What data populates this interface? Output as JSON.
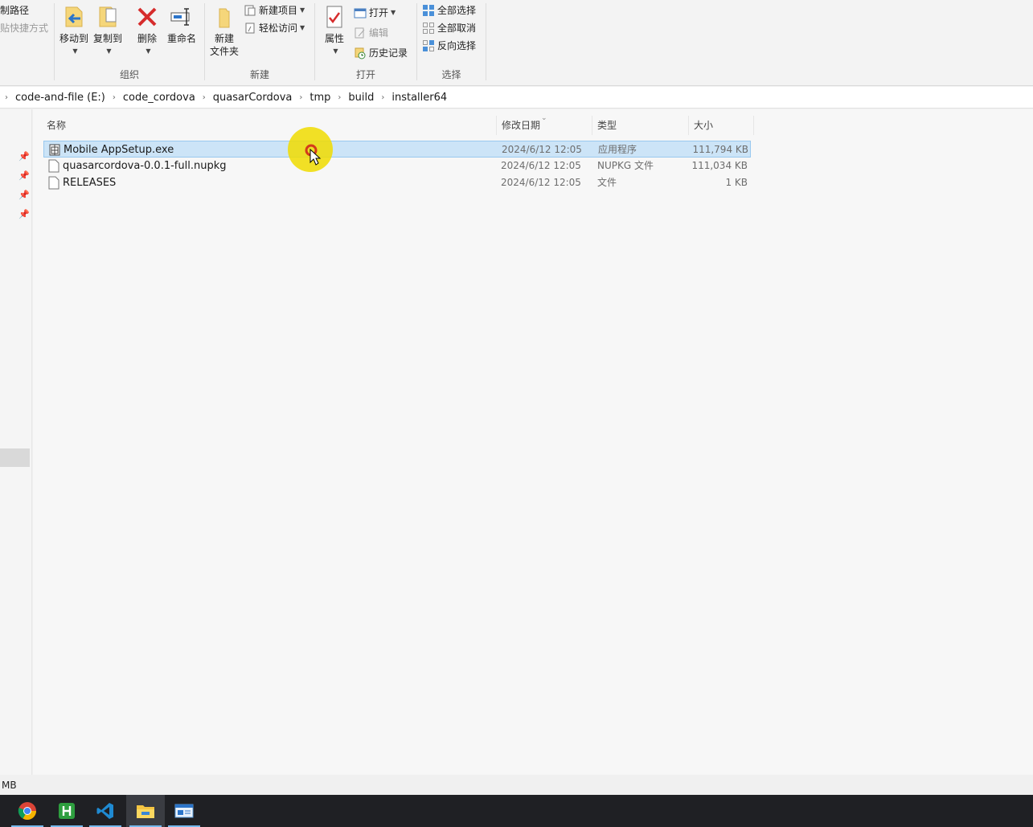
{
  "ribbon": {
    "clipboard": {
      "copy_path": "制路径",
      "paste_shortcut": "贴快捷方式"
    },
    "organize": {
      "label": "组织",
      "move_to": "移动到",
      "copy_to": "复制到",
      "delete": "删除",
      "rename": "重命名"
    },
    "new": {
      "label": "新建",
      "new_folder_line1": "新建",
      "new_folder_line2": "文件夹",
      "new_item": "新建项目",
      "easy_access": "轻松访问"
    },
    "open": {
      "label": "打开",
      "properties": "属性",
      "open": "打开",
      "edit": "编辑",
      "history": "历史记录"
    },
    "select": {
      "label": "选择",
      "select_all": "全部选择",
      "select_none": "全部取消",
      "invert": "反向选择"
    }
  },
  "breadcrumb": [
    "code-and-file (E:)",
    "code_cordova",
    "quasarCordova",
    "tmp",
    "build",
    "installer64"
  ],
  "columns": {
    "name": "名称",
    "date": "修改日期",
    "type": "类型",
    "size": "大小"
  },
  "files": [
    {
      "name": "Mobile AppSetup.exe",
      "date": "2024/6/12 12:05",
      "type": "应用程序",
      "size": "111,794 KB",
      "selected": true
    },
    {
      "name": "quasarcordova-0.0.1-full.nupkg",
      "date": "2024/6/12 12:05",
      "type": "NUPKG 文件",
      "size": "111,034 KB",
      "selected": false
    },
    {
      "name": "RELEASES",
      "date": "2024/6/12 12:05",
      "type": "文件",
      "size": "1 KB",
      "selected": false
    }
  ],
  "status": {
    "text": "MB"
  },
  "taskbar": {
    "apps": [
      "chrome-icon",
      "hbuilder-icon",
      "vscode-icon",
      "file-explorer-icon",
      "app-window-icon"
    ]
  }
}
